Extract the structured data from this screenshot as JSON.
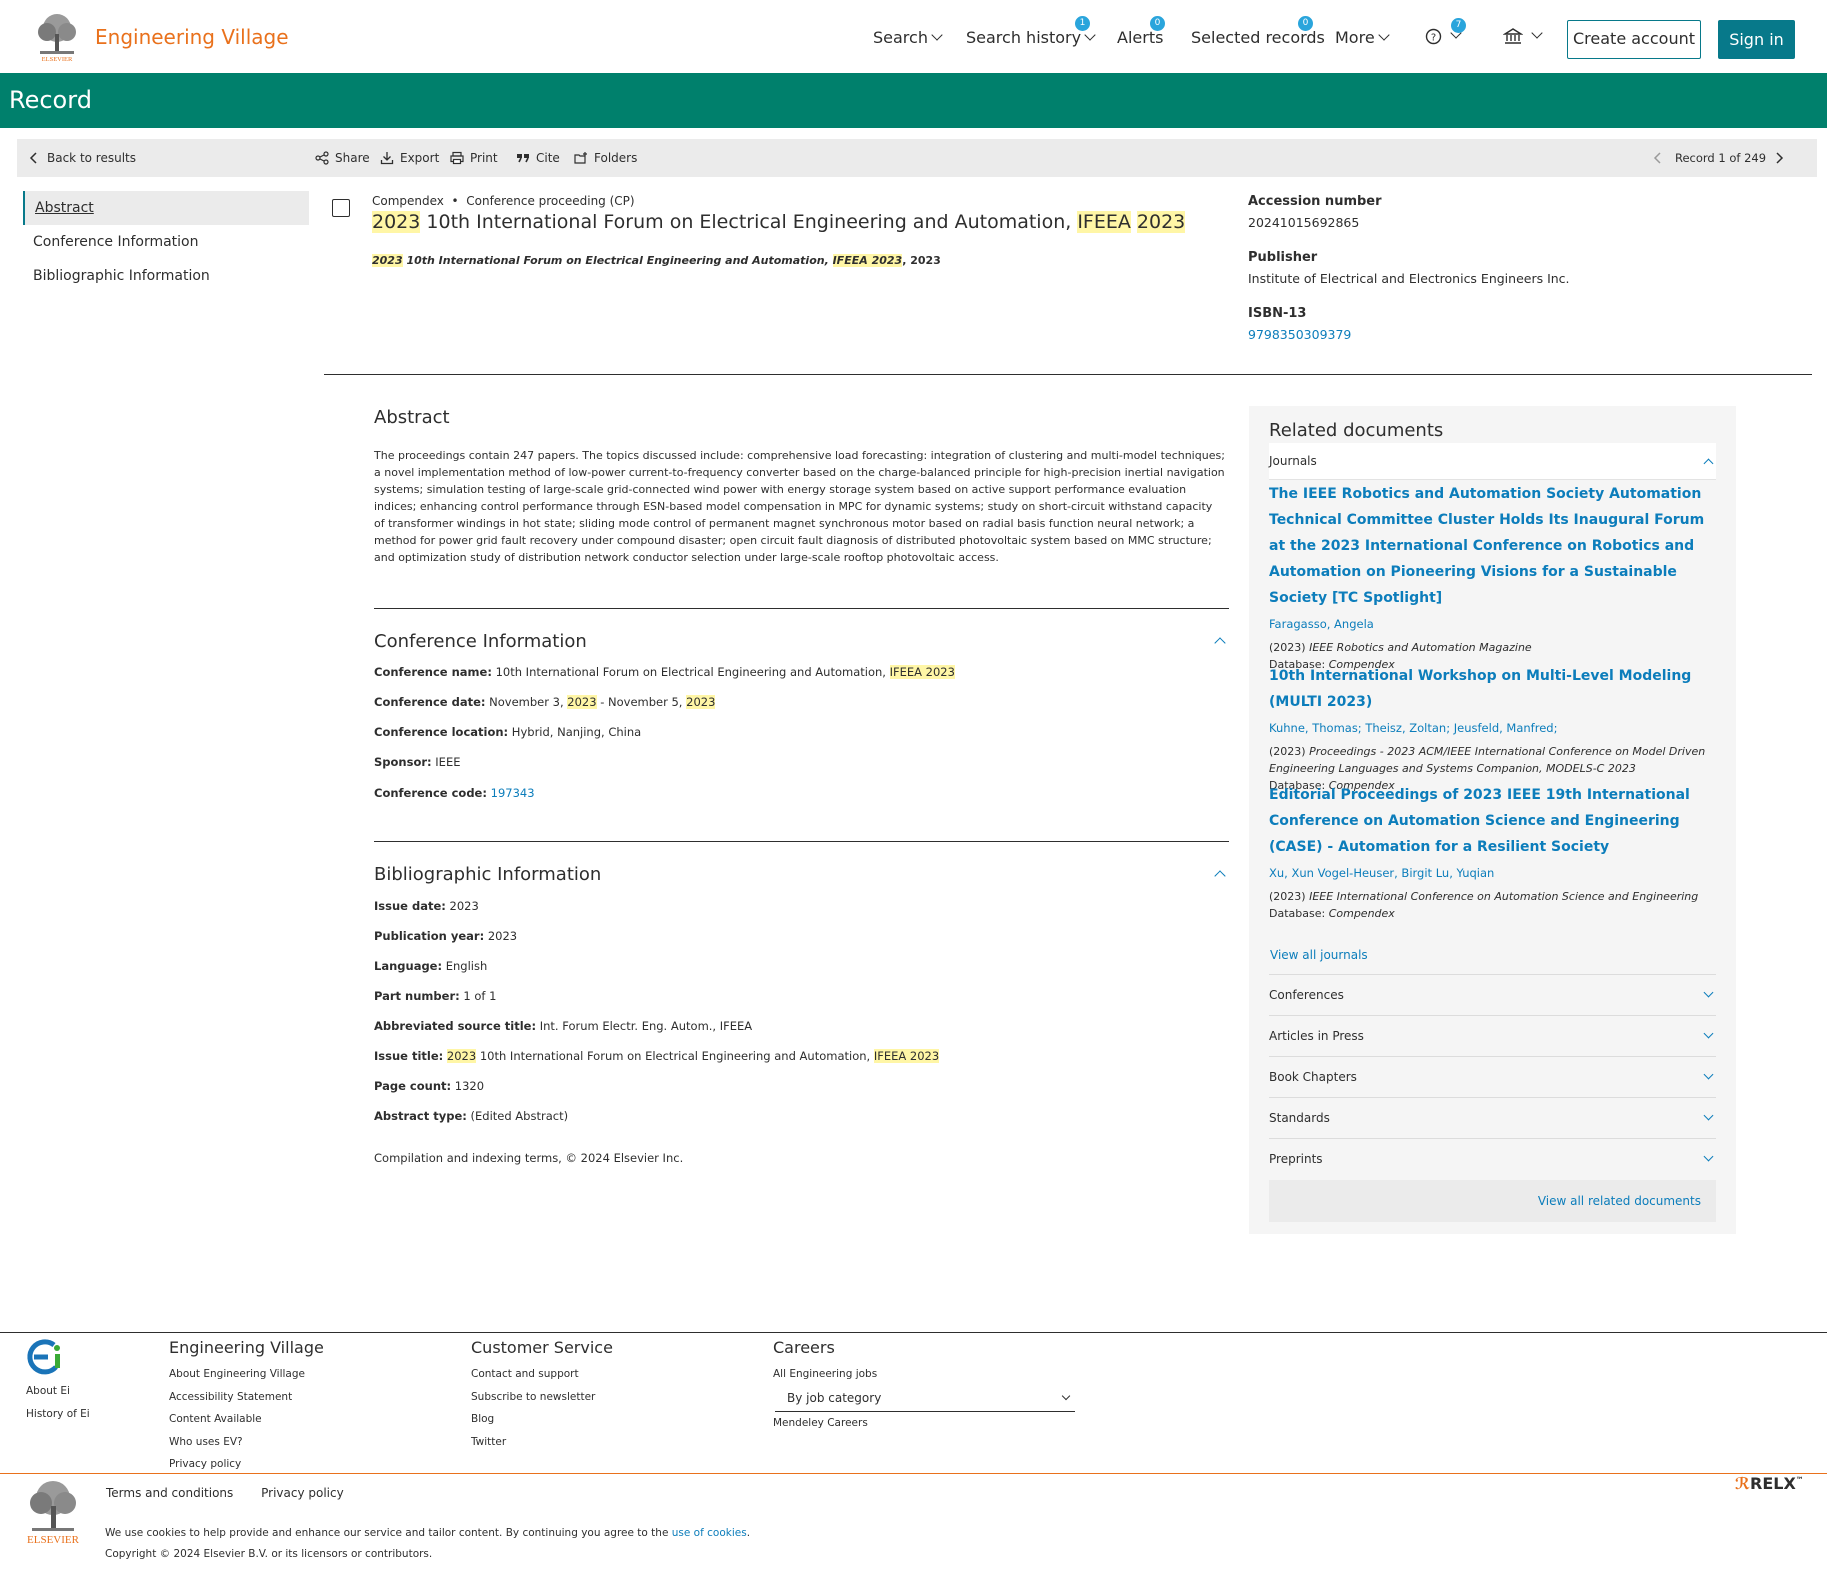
{
  "header": {
    "brand": "Engineering Village",
    "nav": {
      "search": "Search",
      "search_history": "Search history",
      "search_history_badge": "1",
      "alerts": "Alerts",
      "alerts_badge": "0",
      "selected_records": "Selected records",
      "selected_records_badge": "0",
      "more": "More",
      "help_badge": "7"
    },
    "create_account": "Create account",
    "sign_in": "Sign in",
    "accent_color": "#07798a",
    "brand_color": "#e9711c"
  },
  "page_title": "Record",
  "toolbar": {
    "back": "Back to results",
    "share": "Share",
    "export": "Export",
    "print": "Print",
    "cite": "Cite",
    "folders": "Folders",
    "record_position": "Record 1 of 249"
  },
  "leftnav": {
    "abstract": "Abstract",
    "conference": "Conference Information",
    "bibliographic": "Bibliographic Information"
  },
  "record": {
    "database": "Compendex",
    "doc_type": "Conference proceeding (CP)",
    "title_year1": "2023",
    "title_mid": " 10th International Forum on Electrical Engineering and Automation, ",
    "title_ifeea": "IFEEA",
    "title_year2": "2023",
    "sub_year1": "2023",
    "sub_mid": " 10th International Forum on Electrical Engineering and Automation, ",
    "sub_ifeea": "IFEEA 2023",
    "sub_year_tail": ", 2023"
  },
  "rightmeta": {
    "accession_label": "Accession number",
    "accession_value": "20241015692865",
    "publisher_label": "Publisher",
    "publisher_value": "Institute of Electrical and Electronics Engineers Inc.",
    "isbn_label": "ISBN-13",
    "isbn_value": "9798350309379"
  },
  "abstract": {
    "heading": "Abstract",
    "text": "The proceedings contain 247 papers. The topics discussed include: comprehensive load forecasting: integration of clustering and multi-model techniques; a novel implementation method of low-power current-to-frequency converter based on the charge-balanced principle for high-precision inertial navigation systems; simulation testing of large-scale grid-connected wind power with energy storage system based on active support performance evaluation indices; enhancing control performance through ESN-based model compensation in MPC for dynamic systems; study on short-circuit withstand capacity of transformer windings in hot state; sliding mode control of permanent magnet synchronous motor based on radial basis function neural network; a method for power grid fault recovery under compound disaster; open circuit fault diagnosis of distributed photovoltaic system based on MMC structure; and optimization study of distribution network conductor selection under large-scale rooftop photovoltaic access."
  },
  "conference": {
    "heading": "Conference Information",
    "name_label": "Conference name:",
    "name_value": " 10th International Forum on Electrical Engineering and Automation, ",
    "name_hl": "IFEEA 2023",
    "date_label": "Conference date:",
    "date_a": " November 3, ",
    "date_y1": "2023",
    "date_b": " - November 5, ",
    "date_y2": "2023",
    "location_label": "Conference location:",
    "location_value": " Hybrid, Nanjing, China",
    "sponsor_label": "Sponsor:",
    "sponsor_value": " IEEE",
    "code_label": "Conference code:",
    "code_value": "197343"
  },
  "bibliographic": {
    "heading": "Bibliographic Information",
    "issue_date_label": "Issue date:",
    "issue_date_value": " 2023",
    "pub_year_label": "Publication year:",
    "pub_year_value": " 2023",
    "language_label": "Language:",
    "language_value": " English",
    "part_label": "Part number:",
    "part_value": " 1 of 1",
    "abbr_label": "Abbreviated source title:",
    "abbr_value": " Int. Forum Electr. Eng. Autom., IFEEA",
    "issue_title_label": "Issue title:",
    "issue_title_y": "2023",
    "issue_title_mid": " 10th International Forum on Electrical Engineering and Automation, ",
    "issue_title_hl": "IFEEA 2023",
    "page_count_label": "Page count:",
    "page_count_value": " 1320",
    "abstract_type_label": "Abstract type:",
    "abstract_type_value": " (Edited Abstract)",
    "compilation": "Compilation and indexing terms, © 2024 Elsevier Inc."
  },
  "related": {
    "heading": "Related documents",
    "journals_label": "Journals",
    "docs": [
      {
        "title": "The IEEE Robotics and Automation Society Automation Technical Committee Cluster Holds Its Inaugural Forum at the 2023 International Conference on Robotics and Automation on Pioneering Visions for a Sustainable Society [TC Spotlight]",
        "authors": "Faragasso, Angela",
        "year": "(2023) ",
        "source": "IEEE Robotics and Automation Magazine",
        "database": "Database: ",
        "db_name": "Compendex"
      },
      {
        "title": "10th International Workshop on Multi-Level Modeling (MULTI 2023)",
        "authors": "Kuhne, Thomas; Theisz, Zoltan; Jeusfeld, Manfred;",
        "year": "(2023) ",
        "source": "Proceedings - 2023 ACM/IEEE International Conference on Model Driven Engineering Languages and Systems Companion, MODELS-C 2023",
        "database": "Database: ",
        "db_name": "Compendex"
      },
      {
        "title": "Editorial Proceedings of 2023 IEEE 19th International Conference on Automation Science and Engineering (CASE) - Automation for a Resilient Society",
        "authors": " Xu, Xun  Vogel-Heuser, Birgit Lu, Yuqian",
        "year": "(2023) ",
        "source": "IEEE International Conference on Automation Science and Engineering",
        "database": "Database: ",
        "db_name": "Compendex"
      }
    ],
    "view_all_journals": "View all journals",
    "collapsed": [
      "Conferences",
      "Articles in Press",
      "Book Chapters",
      "Standards",
      "Preprints"
    ],
    "view_all_related": "View all related documents"
  },
  "footer": {
    "ei_links": [
      "About Ei",
      "History of Ei"
    ],
    "ev_heading": "Engineering Village",
    "ev_links": [
      "About Engineering Village",
      "Accessibility Statement",
      "Content Available",
      "Who uses EV?",
      "Privacy policy"
    ],
    "cs_heading": "Customer Service",
    "cs_links": [
      "Contact and support",
      "Subscribe to newsletter",
      "Blog",
      "Twitter"
    ],
    "careers_heading": "Careers",
    "careers_all": "All Engineering jobs",
    "careers_select": "By job category",
    "careers_mendeley": "Mendeley Careers",
    "terms": "Terms and conditions",
    "privacy": "Privacy policy",
    "cookie_text": "We use cookies to help provide and enhance our service and tailor content. By continuing you agree to the ",
    "cookie_link": "use of cookies",
    "cookie_end": ".",
    "copyright": "Copyright © 2024 Elsevier B.V. or its licensors or contributors.",
    "elsevier_label": "ELSEVIER",
    "relx": "RELX",
    "relx_tm": "™"
  }
}
